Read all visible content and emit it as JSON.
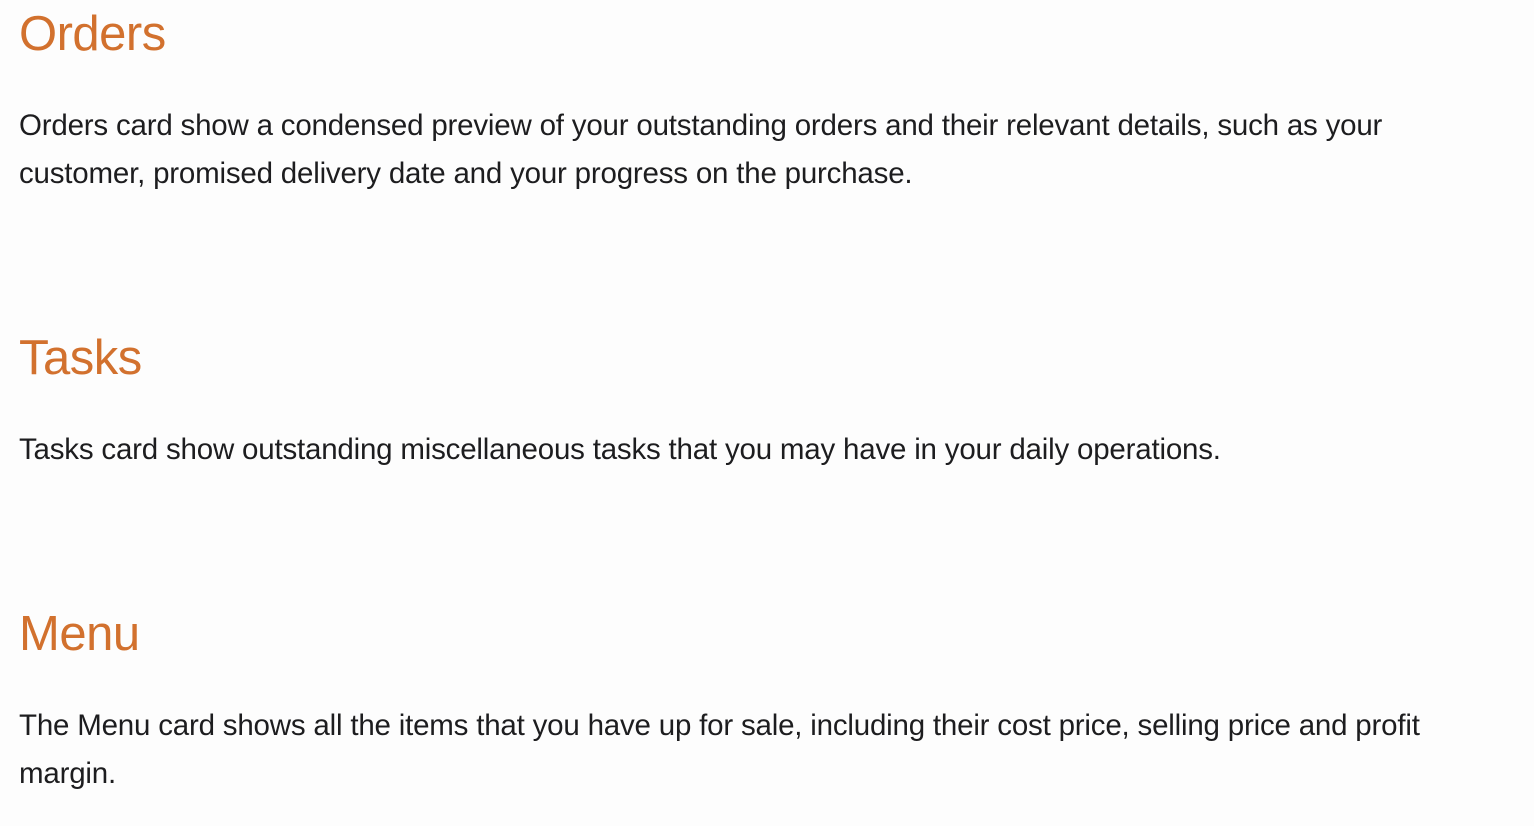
{
  "theme": {
    "heading_color": "#d2712e",
    "text_color": "#1d1d1f",
    "background": "#fdfdfd"
  },
  "sections": [
    {
      "title": "Orders",
      "body": "Orders card show a condensed preview of your outstanding orders and their relevant details, such as your customer, promised delivery date and your progress on the purchase."
    },
    {
      "title": "Tasks",
      "body": "Tasks card show outstanding miscellaneous tasks that you may have in your daily operations."
    },
    {
      "title": "Menu",
      "body": "The Menu card shows all the items that you have up for sale, including their cost price, selling price and profit margin."
    }
  ]
}
